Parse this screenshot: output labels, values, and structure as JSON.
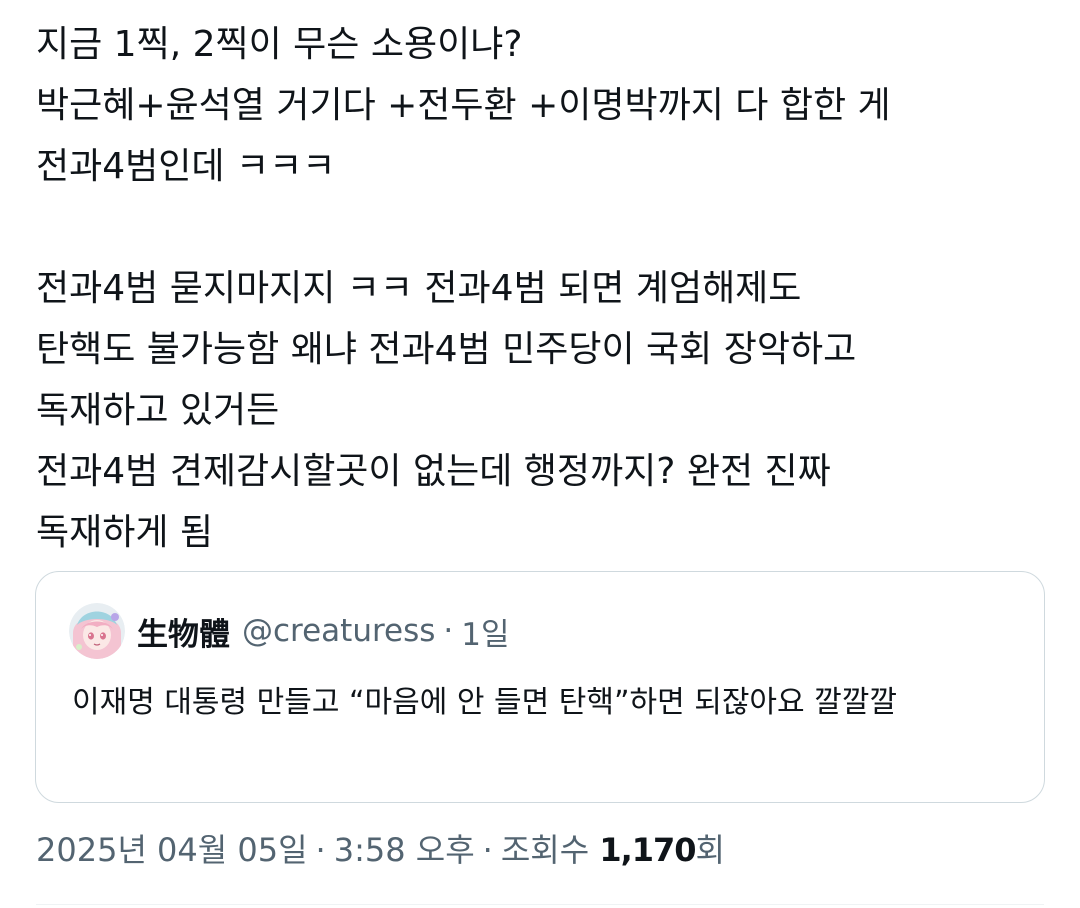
{
  "tweet": {
    "lines": [
      "지금 1찍, 2찍이 무슨 소용이냐?",
      "박근혜+윤석열 거기다 +전두환 +이명박까지 다 합한 게",
      "전과4범인데 ㅋㅋㅋ",
      "",
      "전과4범 묻지마지지 ㅋㅋ 전과4범 되면 계엄해제도",
      "탄핵도 불가능함 왜냐 전과4범 민주당이 국회 장악하고",
      "독재하고 있거든",
      "전과4범 견제감시할곳이 없는데 행정까지? 완전 진짜",
      "독재하게 됨"
    ]
  },
  "quote": {
    "avatar_icon": "anime-avatar-icon",
    "name": "生物體",
    "handle": "@creaturess",
    "dot": "·",
    "time": "1일",
    "text": "이재명 대통령 만들고 “마음에 안 들면 탄핵”하면 되잖아요 깔깔깔"
  },
  "meta": {
    "date": "2025년 04월 05일",
    "sep1": "·",
    "time": "3:58 오후",
    "sep2": "·",
    "views_label": "조회수",
    "views_count": "1,170",
    "views_suffix": "회"
  },
  "colors": {
    "text": "#0f1419",
    "secondary": "#536471",
    "border": "#cfd9de"
  }
}
